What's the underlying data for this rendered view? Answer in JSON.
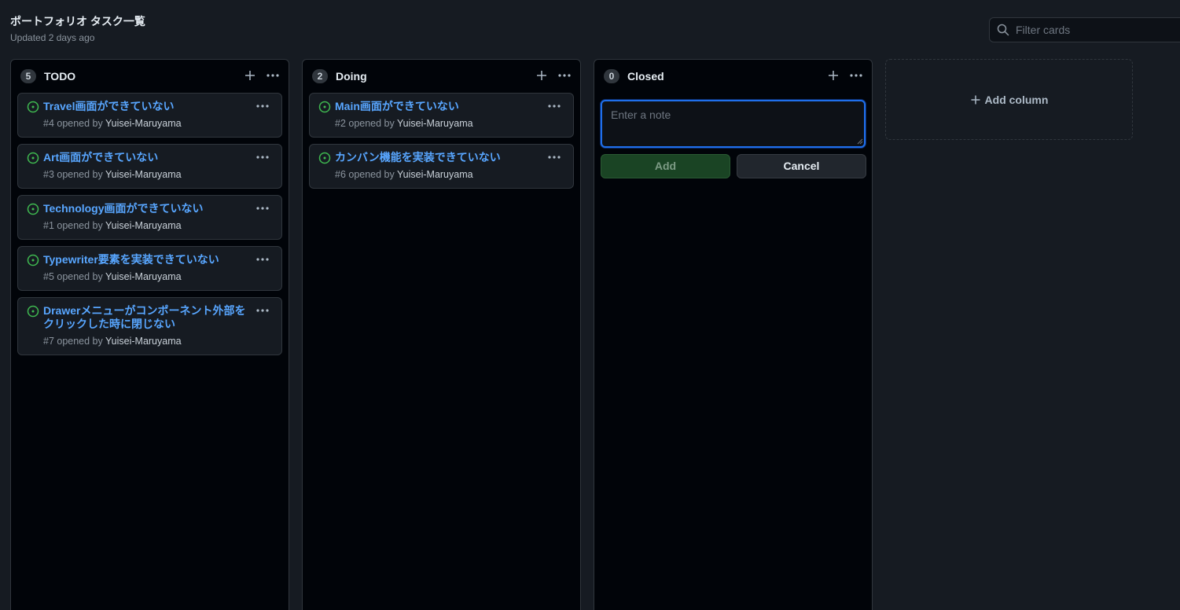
{
  "page": {
    "title": "ポートフォリオ タスク一覧",
    "updated": "Updated 2 days ago"
  },
  "filter": {
    "placeholder": "Filter cards"
  },
  "columns": [
    {
      "name": "TODO",
      "count": "5",
      "cards": [
        {
          "title": "Travel画面ができていない",
          "meta": "#4 opened by",
          "author": "Yuisei-Maruyama"
        },
        {
          "title": "Art画面ができていない",
          "meta": "#3 opened by",
          "author": "Yuisei-Maruyama"
        },
        {
          "title": "Technology画面ができていない",
          "meta": "#1 opened by",
          "author": "Yuisei-Maruyama"
        },
        {
          "title": "Typewriter要素を実装できていない",
          "meta": "#5 opened by",
          "author": "Yuisei-Maruyama"
        },
        {
          "title": "Drawerメニューがコンポーネント外部をクリックした時に閉じない",
          "meta": "#7 opened by",
          "author": "Yuisei-Maruyama"
        }
      ]
    },
    {
      "name": "Doing",
      "count": "2",
      "cards": [
        {
          "title": "Main画面ができていない",
          "meta": "#2 opened by",
          "author": "Yuisei-Maruyama"
        },
        {
          "title": "カンバン機能を実装できていない",
          "meta": "#6 opened by",
          "author": "Yuisei-Maruyama"
        }
      ]
    },
    {
      "name": "Closed",
      "count": "0",
      "note_placeholder": "Enter a note",
      "add_label": "Add",
      "cancel_label": "Cancel"
    }
  ],
  "add_column": {
    "label": "Add column"
  },
  "colors": {
    "accent_link": "#58a6ff",
    "open_issue": "#3fb950",
    "focus": "#1f6feb"
  },
  "icons": [
    "search-icon",
    "plus-icon",
    "kebab-icon",
    "issue-opened-icon"
  ]
}
